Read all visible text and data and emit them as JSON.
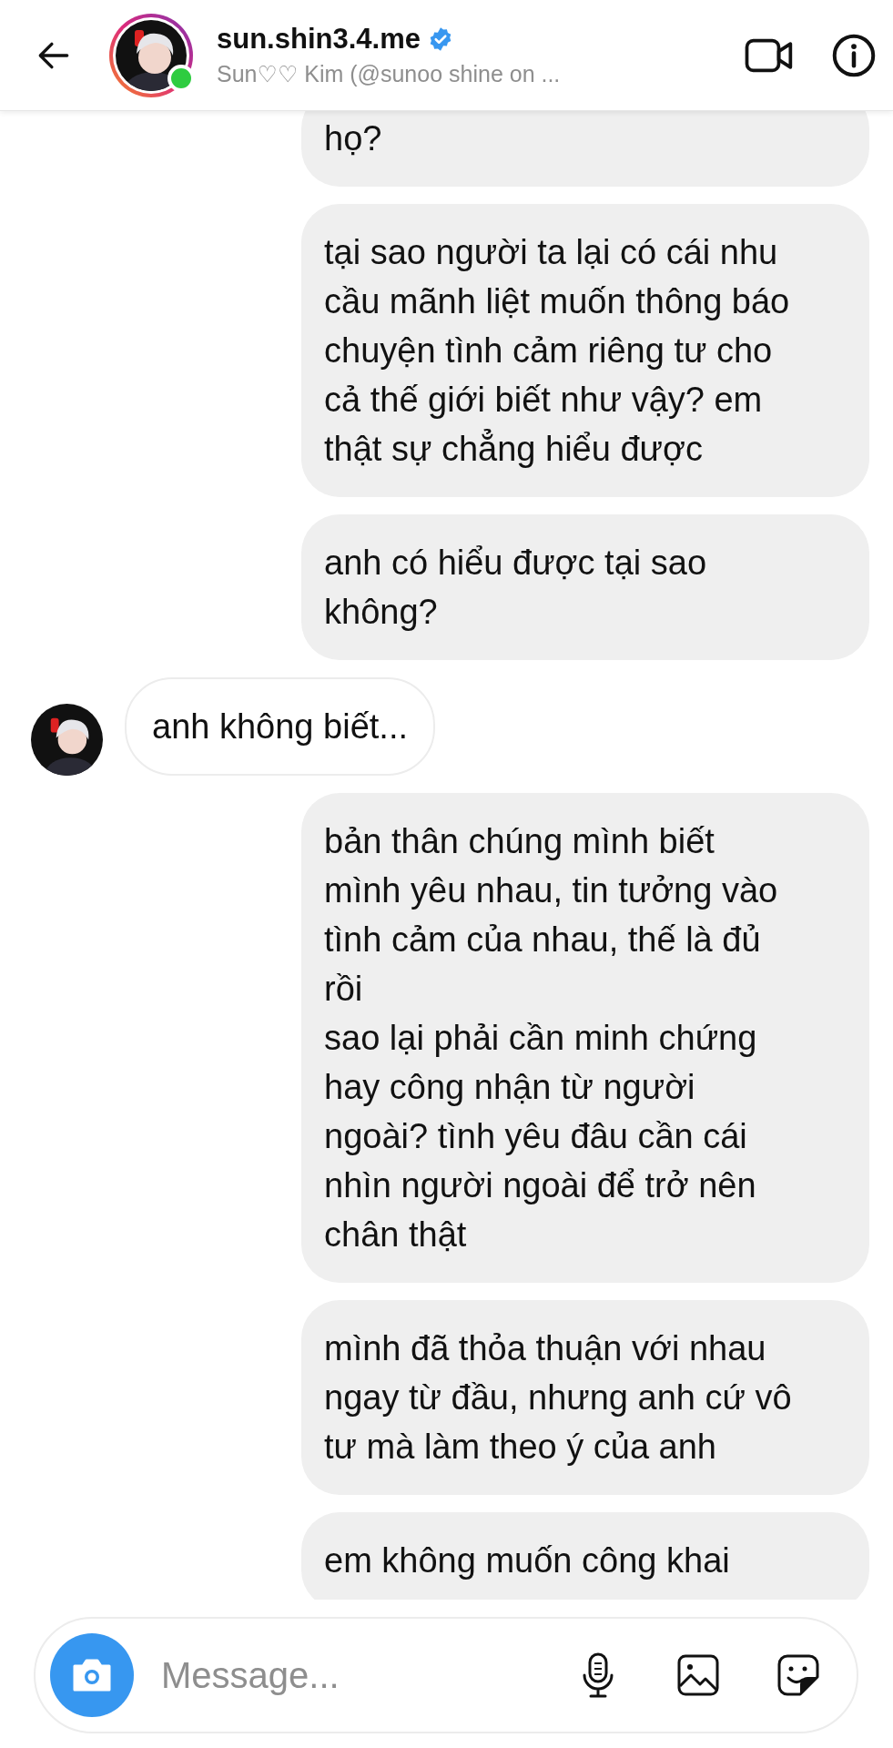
{
  "header": {
    "username": "sun.shin3.4.me",
    "verified": true,
    "online": true,
    "subtitle": "Sun♡♡ Kim (@sunoo shine on ..."
  },
  "messages": [
    {
      "kind": "outgoing",
      "text": "họ?"
    },
    {
      "kind": "outgoing",
      "text": "tại sao người ta lại có cái nhu\ncầu mãnh liệt muốn thông báo\nchuyện tình cảm riêng tư cho\ncả thế giới biết như vậy? em\nthật sự chẳng hiểu được"
    },
    {
      "kind": "outgoing",
      "text": "anh có hiểu được tại sao\nkhông?"
    },
    {
      "kind": "incoming",
      "text": "anh không biết..."
    },
    {
      "kind": "outgoing",
      "text": "bản thân chúng mình biết\nmình yêu nhau, tin tưởng vào\ntình cảm của nhau, thế là đủ\nrồi\nsao lại phải cần minh chứng\nhay công nhận từ người\nngoài? tình yêu đâu cần cái\nnhìn người ngoài để trở nên\nchân thật"
    },
    {
      "kind": "outgoing",
      "text": "mình đã thỏa thuận với nhau\nngay từ đầu, nhưng anh cứ vô\ntư mà làm theo ý của anh"
    },
    {
      "kind": "outgoing",
      "text": "em không muốn công khai"
    }
  ],
  "composer": {
    "placeholder": "Message..."
  }
}
